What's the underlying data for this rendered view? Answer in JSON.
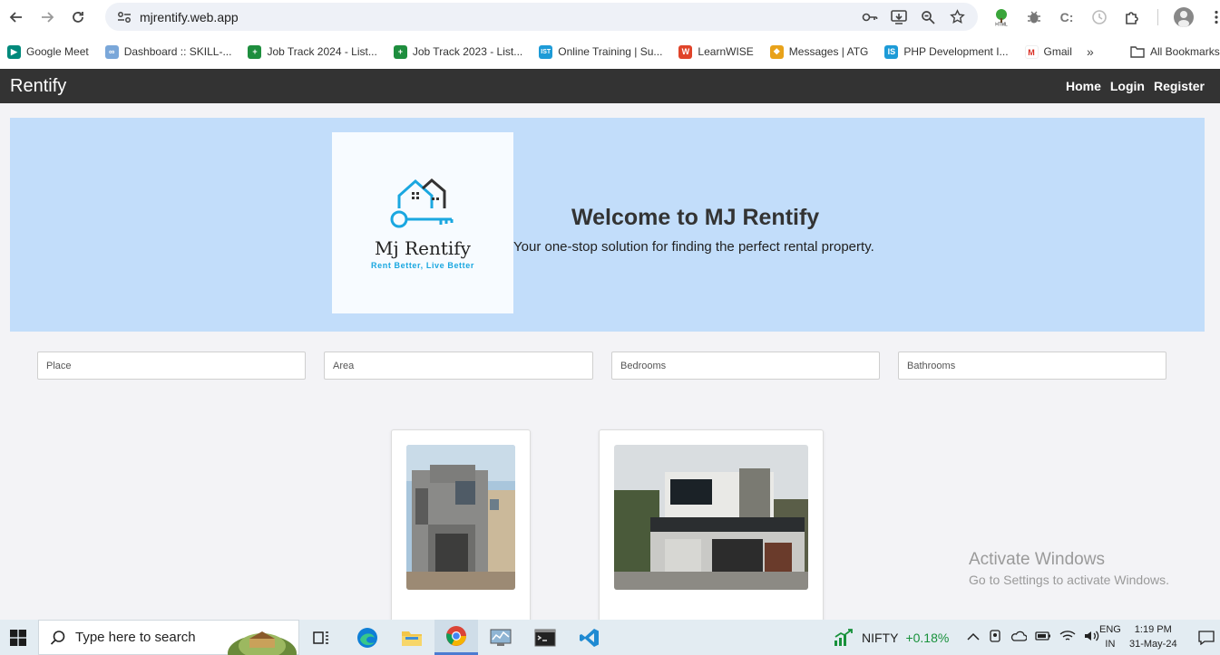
{
  "browser": {
    "url": "mjrentify.web.app",
    "bookmarks": [
      {
        "label": "Google Meet",
        "color": "#00897b",
        "glyph": "▶"
      },
      {
        "label": "Dashboard :: SKILL-...",
        "color": "#7aa7d9",
        "glyph": "∞"
      },
      {
        "label": "Job Track 2024 - List...",
        "color": "#1e8e3e",
        "glyph": "+"
      },
      {
        "label": "Job Track 2023 - List...",
        "color": "#1e8e3e",
        "glyph": "+"
      },
      {
        "label": "Online Training | Su...",
        "color": "#1d9bd7",
        "glyph": "IST"
      },
      {
        "label": "LearnWISE",
        "color": "#e0442a",
        "glyph": "W"
      },
      {
        "label": "Messages | ATG",
        "color": "#e8a21a",
        "glyph": "❖"
      },
      {
        "label": "PHP Development I...",
        "color": "#1d9bd7",
        "glyph": "IS"
      },
      {
        "label": "Gmail",
        "color": "#d93025",
        "glyph": "M"
      }
    ],
    "all_bookmarks": "All Bookmarks",
    "more": "»"
  },
  "site": {
    "brand": "Rentify",
    "nav": {
      "home": "Home",
      "login": "Login",
      "register": "Register"
    },
    "hero": {
      "logo_name": "Mj Rentify",
      "logo_tagline": "Rent Better, Live Better",
      "title": "Welcome to MJ Rentify",
      "subtitle": "Your one-stop solution for finding the perfect rental property."
    },
    "filters": {
      "place": "Place",
      "area": "Area",
      "bedrooms": "Bedrooms",
      "bathrooms": "Bathrooms"
    }
  },
  "watermark": {
    "line1": "Activate Windows",
    "line2": "Go to Settings to activate Windows."
  },
  "taskbar": {
    "search_placeholder": "Type here to search",
    "nifty_label": "NIFTY",
    "nifty_change": "+0.18%",
    "lang1": "ENG",
    "lang2": "IN",
    "time": "1:19 PM",
    "date": "31-May-24"
  },
  "colors": {
    "navbar": "#333333",
    "hero_bg": "#c2ddfa",
    "logo_accent": "#1aa7e0",
    "nifty_up": "#18913b"
  }
}
